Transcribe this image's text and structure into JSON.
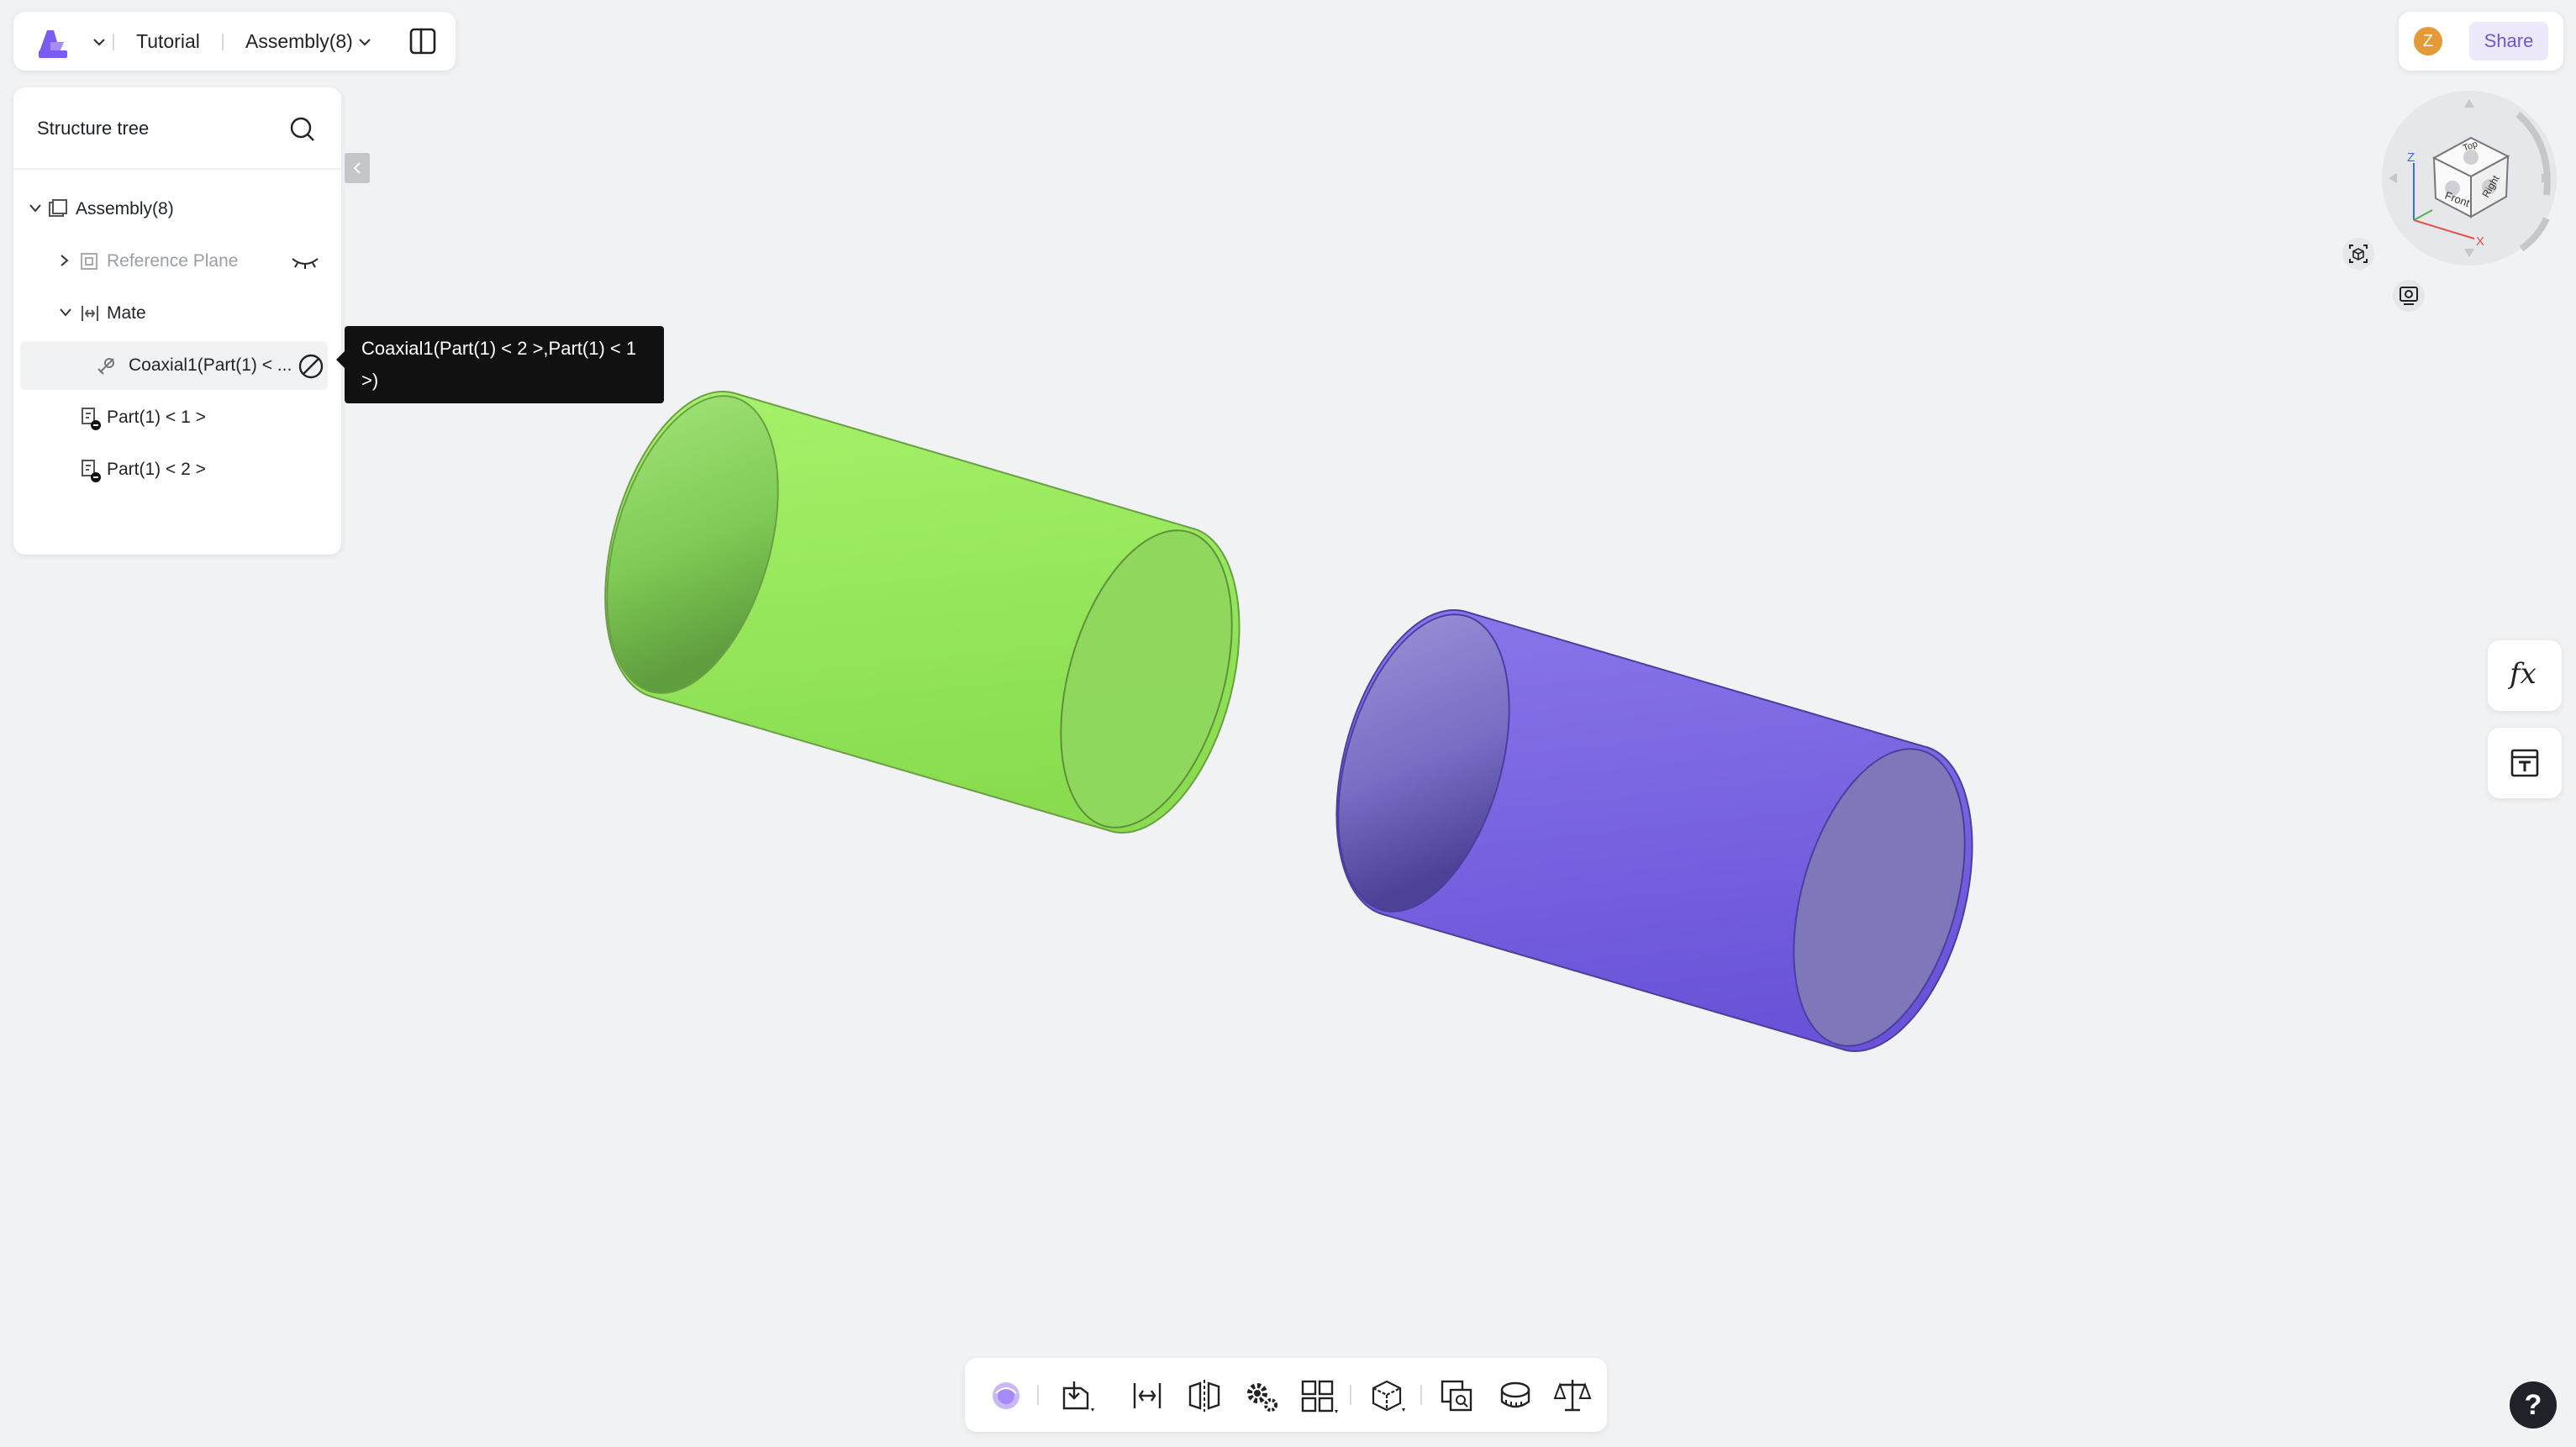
{
  "topbar": {
    "project": "Tutorial",
    "document": "Assembly(8)"
  },
  "tree": {
    "header": "Structure tree",
    "items": [
      {
        "label": "Assembly(8)"
      },
      {
        "label": "Reference Plane"
      },
      {
        "label": "Mate"
      },
      {
        "label": "Coaxial1(Part(1) < ..."
      },
      {
        "label": "Part(1) < 1 >"
      },
      {
        "label": "Part(1) < 2 >"
      }
    ]
  },
  "tooltip": {
    "line1": "Coaxial1(Part(1) < 2 >,Part(1) < 1",
    "line2": ">)"
  },
  "user": {
    "avatar_initial": "Z",
    "share_label": "Share"
  },
  "navcube": {
    "faces": [
      "Top",
      "Front",
      "Right"
    ],
    "axes": [
      "Z",
      "X"
    ]
  },
  "side_tools": {
    "formula_label": "fx"
  },
  "help_label": "?",
  "colors": {
    "accent": "#7b5cf0",
    "part_green": "#9aea5c",
    "part_purple": "#7a63e6"
  }
}
